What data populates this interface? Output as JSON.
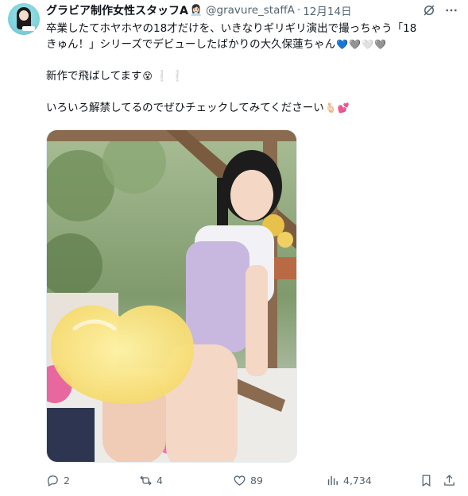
{
  "author": {
    "display_name": "グラビア制作女性スタッフA",
    "name_emoji": "👩🏻‍💼",
    "handle": "@gravure_staffA",
    "separator": "·",
    "date": "12月14日"
  },
  "icons": {
    "avatar": "avatar-image",
    "grok": "grok-icon",
    "more": "more-icon",
    "reply": "reply-icon",
    "retweet": "retweet-icon",
    "like": "heart-icon",
    "views": "views-icon",
    "bookmark": "bookmark-icon",
    "share": "share-icon"
  },
  "tweet": {
    "line1": "卒業したてホヤホヤの18才だけを、いきなりギリギリ演出で撮っちゃう「18",
    "line2": "きゅん！」シリーズでデビューしたばかりの大久保蓮ちゃん",
    "line2_emojis": [
      "💙",
      "🩶",
      "🤍",
      "🩶"
    ],
    "line3": "新作で飛ばしてます",
    "line3_emoji": "😵",
    "line3_marks": [
      "❕",
      "❕"
    ],
    "line4": "いろいろ解禁してるのでぜひチェックしてみてくださーい",
    "line4_emojis": [
      "🫰🏻",
      "💕"
    ]
  },
  "media": {
    "type": "photo",
    "description_icon": "photo-image"
  },
  "actions": {
    "replies": "2",
    "retweets": "4",
    "likes": "89",
    "views": "4,734"
  },
  "colors": {
    "text": "#0f1419",
    "secondary": "#536471",
    "heart_blue": "#5aa9e6",
    "heart_pink": "#e0245e"
  }
}
